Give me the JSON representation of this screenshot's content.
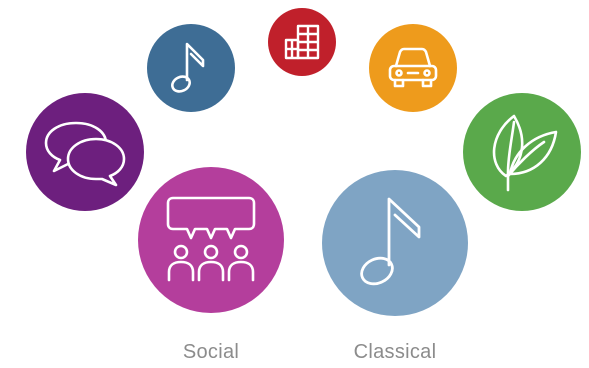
{
  "bubbles": [
    {
      "id": "chat",
      "icon": "chat-bubbles-icon",
      "color": "#6d1f7e"
    },
    {
      "id": "music-small",
      "icon": "music-note-icon",
      "color": "#3e6d95"
    },
    {
      "id": "city",
      "icon": "city-buildings-icon",
      "color": "#c0202b"
    },
    {
      "id": "car",
      "icon": "car-icon",
      "color": "#ee9b1c"
    },
    {
      "id": "nature",
      "icon": "leaf-icon",
      "color": "#5aa94b"
    },
    {
      "id": "social",
      "icon": "group-speech-icon",
      "color": "#b43e9c"
    },
    {
      "id": "classical",
      "icon": "music-note-icon",
      "color": "#7fa4c4"
    }
  ],
  "labels": {
    "social": "Social",
    "classical": "Classical"
  }
}
